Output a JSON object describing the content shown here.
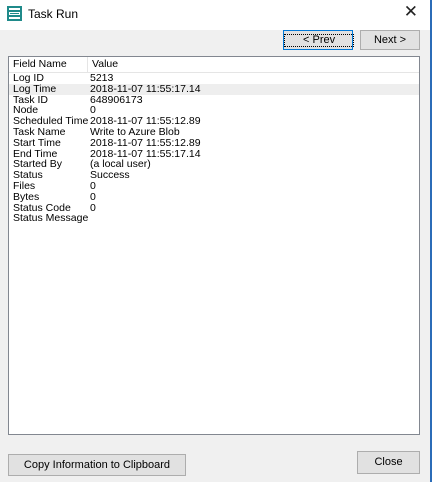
{
  "window": {
    "title": "Task Run",
    "close_glyph": "✕"
  },
  "toolbar": {
    "prev_label": "< Prev",
    "next_label": "Next >"
  },
  "list": {
    "columns": [
      "Field Name",
      "Value"
    ],
    "rows": [
      {
        "field": "Log ID",
        "value": "5213"
      },
      {
        "field": "Log Time",
        "value": "2018-11-07 11:55:17.14"
      },
      {
        "field": "Task ID",
        "value": "648906173"
      },
      {
        "field": "Node",
        "value": "0"
      },
      {
        "field": "Scheduled Time",
        "value": "2018-11-07 11:55:12.89"
      },
      {
        "field": "Task Name",
        "value": "Write to Azure Blob"
      },
      {
        "field": "Start Time",
        "value": "2018-11-07 11:55:12.89"
      },
      {
        "field": "End Time",
        "value": "2018-11-07 11:55:17.14"
      },
      {
        "field": "Started By",
        "value": "(a local user)"
      },
      {
        "field": "Status",
        "value": "Success"
      },
      {
        "field": "Files",
        "value": "0"
      },
      {
        "field": "Bytes",
        "value": "0"
      },
      {
        "field": "Status Code",
        "value": "0"
      },
      {
        "field": "Status Message",
        "value": ""
      }
    ]
  },
  "footer": {
    "copy_label": "Copy Information to Clipboard",
    "close_label": "Close"
  },
  "colors": {
    "accent": "#0078d7",
    "app_icon": "#1f8a8a"
  },
  "icons": {
    "app": "task-app-icon",
    "close": "close-icon"
  }
}
